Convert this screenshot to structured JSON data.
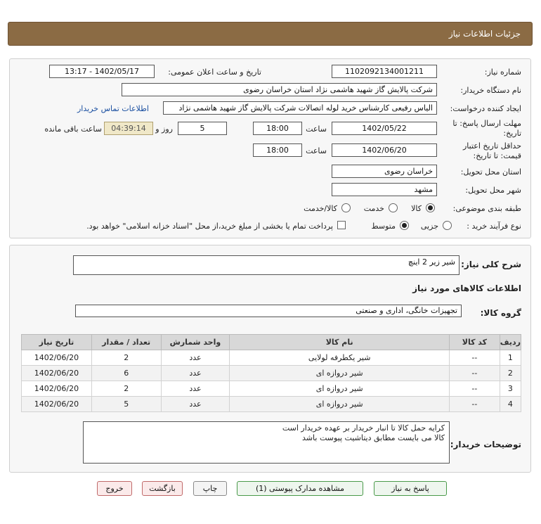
{
  "header": {
    "title": "جزئیات اطلاعات نیاز"
  },
  "form": {
    "need_number_label": "شماره نیاز:",
    "need_number": "1102092134001211",
    "announce_label": "تاریخ و ساعت اعلان عمومی:",
    "announce_value": "1402/05/17 - 13:17",
    "buyer_org_label": "نام دستگاه خریدار:",
    "buyer_org": "شرکت پالایش گاز شهید هاشمی نژاد   استان خراسان رضوی",
    "creator_label": "ایجاد کننده درخواست:",
    "creator": "الیاس رفیعی کارشناس خرید لوله اتصالات شرکت پالایش گاز شهید هاشمی نژاد",
    "contact_link": "اطلاعات تماس خریدار",
    "reply_deadline_label_1": "مهلت ارسال پاسخ: تا",
    "reply_deadline_label_2": "تاریخ:",
    "reply_date": "1402/05/22",
    "time_label": "ساعت",
    "reply_time": "18:00",
    "days": "5",
    "days_label": "روز و",
    "remaining_time": "04:39:14",
    "remaining_label": "ساعت باقی مانده",
    "validity_label_1": "حداقل تاریخ اعتبار",
    "validity_label_2": "قیمت: تا تاریخ:",
    "validity_date": "1402/06/20",
    "validity_time": "18:00",
    "province_label": "استان محل تحویل:",
    "province": "خراسان رضوی",
    "city_label": "شهر محل تحویل:",
    "city": "مشهد",
    "category_label": "طبقه بندی موضوعی:",
    "category_options": [
      "کالا",
      "خدمت",
      "کالا/خدمت"
    ],
    "process_label": "نوع فرآیند خرید :",
    "process_options": [
      "جزیی",
      "متوسط"
    ],
    "treasury_note": "پرداخت تمام یا بخشی از مبلغ خرید،از محل \"اسناد خزانه اسلامی\" خواهد بود."
  },
  "summary": {
    "label": "شرح کلی نیاز:",
    "value": "شیر زیر 2 اینچ",
    "goods_info_title": "اطلاعات کالاهای مورد نیاز",
    "group_label": "گروه کالا:",
    "group_value": "تجهیزات خانگی، اداری و صنعتی"
  },
  "table": {
    "headers": [
      "ردیف",
      "کد کالا",
      "نام کالا",
      "واحد شمارش",
      "تعداد / مقدار",
      "تاریخ نیاز"
    ],
    "rows": [
      [
        "1",
        "--",
        "شیر یکطرفه لولایی",
        "عدد",
        "2",
        "1402/06/20"
      ],
      [
        "2",
        "--",
        "شیر دروازه ای",
        "عدد",
        "6",
        "1402/06/20"
      ],
      [
        "3",
        "--",
        "شیر دروازه ای",
        "عدد",
        "2",
        "1402/06/20"
      ],
      [
        "4",
        "--",
        "شیر دروازه ای",
        "عدد",
        "5",
        "1402/06/20"
      ]
    ]
  },
  "notes": {
    "label": "توضیحات خریدار:",
    "line1": "کرایه حمل کالا تا انبار خریدار بر عهده خریدار است",
    "line2": "کالا می بایست مطابق دیتاشیت پیوست باشد"
  },
  "buttons": {
    "reply": "پاسخ به نیاز",
    "attachments": "مشاهده مدارک پیوستی (1)",
    "print": "چاپ",
    "back": "بازگشت",
    "exit": "خروج"
  }
}
